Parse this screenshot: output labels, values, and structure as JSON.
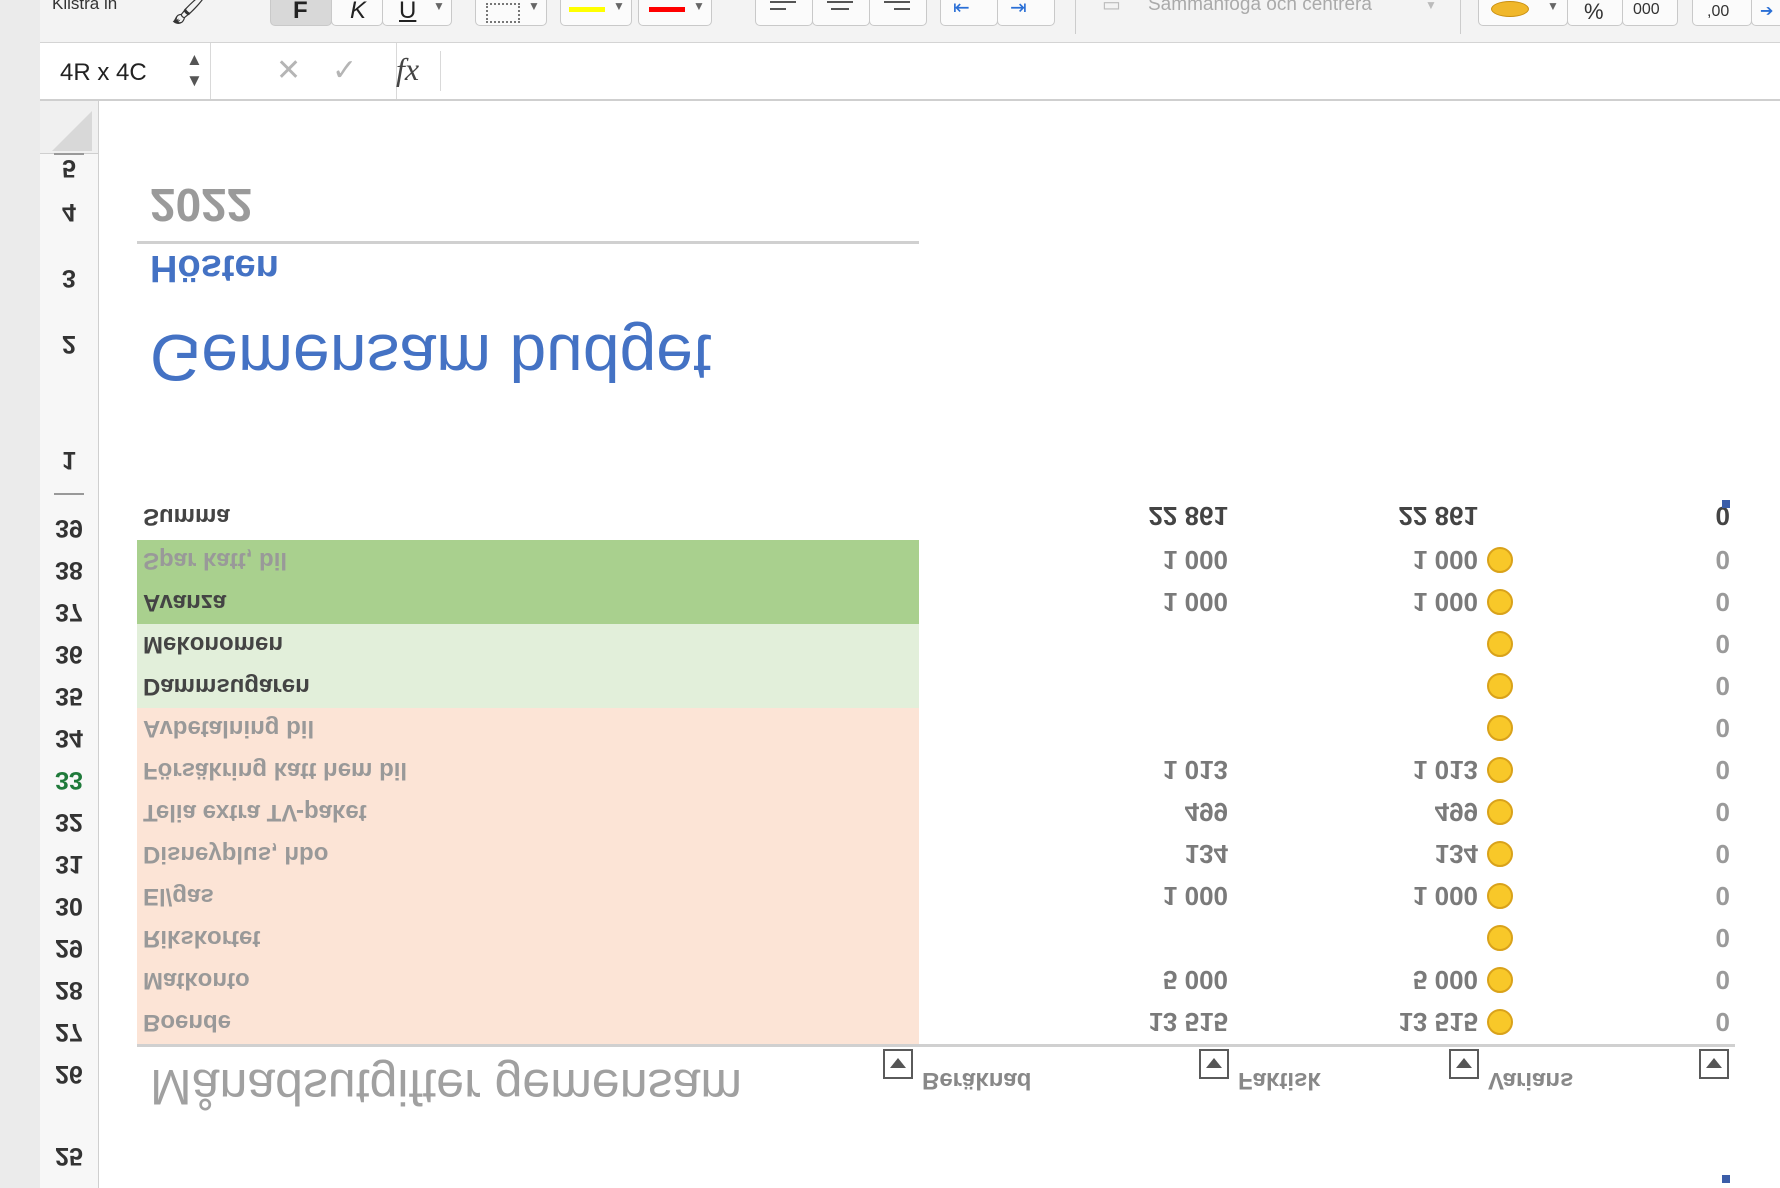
{
  "ribbon": {
    "paste_label": "Klistra in",
    "bold_label": "F",
    "italic_label": "K",
    "underline_label": "U",
    "merge_label": "Sammanfoga och centrera",
    "percent_label": "%",
    "thousands_label": "000",
    "decimal_label": ",00"
  },
  "formula_bar": {
    "name_box_value": "4R x 4C",
    "fx_label": "fx"
  },
  "rows": [
    "2",
    "3",
    "4",
    "5",
    "26",
    "27",
    "28",
    "29",
    "30",
    "31",
    "32",
    "33",
    "34",
    "35",
    "36",
    "37",
    "38",
    "39",
    "25"
  ],
  "title": {
    "main": "Gemensam budget",
    "season": "Hösten",
    "year": "2022"
  },
  "table": {
    "heading": "Månadsutgifter gemensam",
    "columns": [
      "Beräknad",
      "Faktisk",
      "Varians"
    ],
    "rows": [
      {
        "label": "Boende",
        "estimated": "13 515",
        "actual": "13 515",
        "variance": "0"
      },
      {
        "label": "Matkonto",
        "estimated": "5 000",
        "actual": "5 000",
        "variance": "0"
      },
      {
        "label": "Rikskortet",
        "estimated": "",
        "actual": "",
        "variance": "0"
      },
      {
        "label": "El/gas",
        "estimated": "1 000",
        "actual": "1 000",
        "variance": "0"
      },
      {
        "label": "Disneyplus, hbo",
        "estimated": "134",
        "actual": "134",
        "variance": "0"
      },
      {
        "label": "Telia extra TV-paket",
        "estimated": "499",
        "actual": "499",
        "variance": "0"
      },
      {
        "label": "Försäkring katt hem bil",
        "estimated": "1 013",
        "actual": "1 013",
        "variance": "0"
      },
      {
        "label": "Avbetalning bil",
        "estimated": "",
        "actual": "",
        "variance": "0"
      },
      {
        "label": "Dammsugaren",
        "estimated": "",
        "actual": "",
        "variance": "0"
      },
      {
        "label": "Mekonomen",
        "estimated": "",
        "actual": "",
        "variance": "0"
      },
      {
        "label": "Avanza",
        "estimated": "1 000",
        "actual": "1 000",
        "variance": "0"
      },
      {
        "label": "Spar katt, bil",
        "estimated": "1 000",
        "actual": "1 000",
        "variance": "0"
      }
    ],
    "total": {
      "label": "Summa",
      "estimated": "22 861",
      "actual": "22 861",
      "variance": "0"
    }
  },
  "colors": {
    "title_blue": "#4472c4",
    "expense_fill": "#fce4d6",
    "saving_light_fill": "#e2efda",
    "saving_fill": "#a9d08e",
    "active_row": "#1f7a3a"
  }
}
